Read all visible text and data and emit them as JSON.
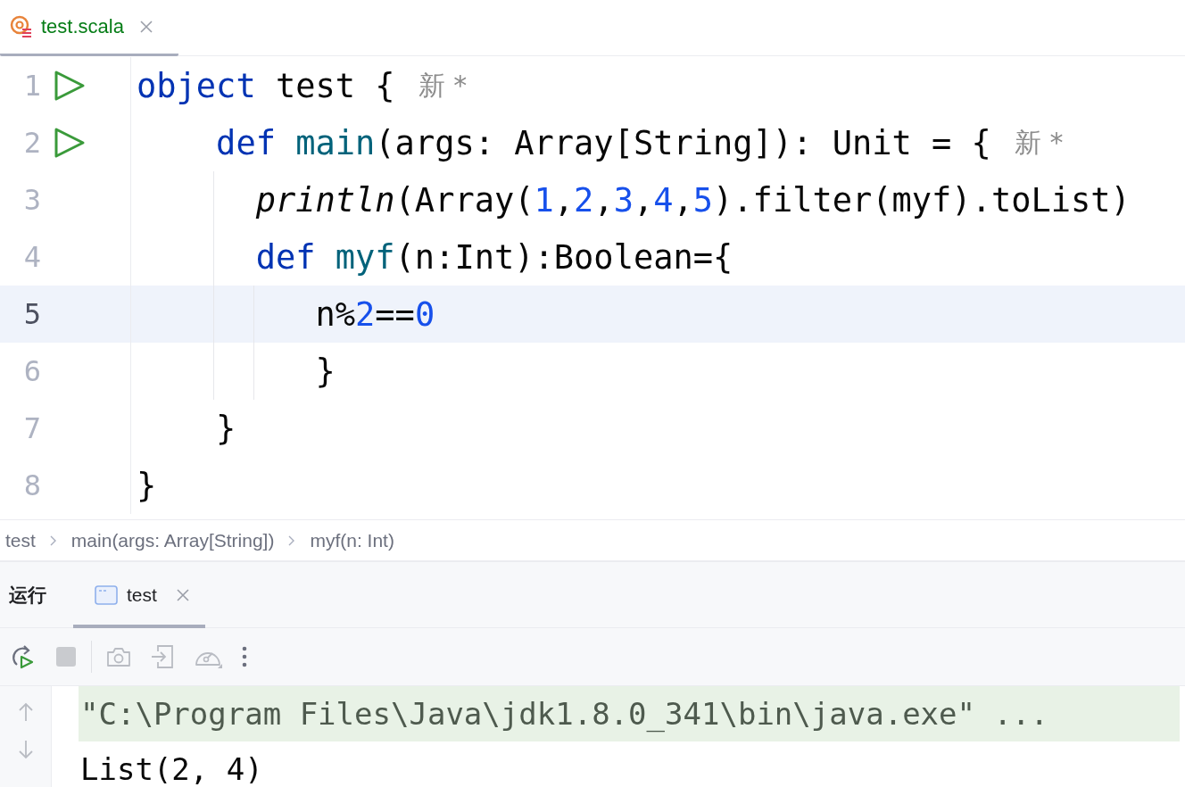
{
  "editor_tab": {
    "file_name": "test.scala",
    "selected": true
  },
  "code_lines": [
    {
      "number": "1",
      "run_button": true,
      "current": false,
      "tokens": [
        {
          "kind": "kw",
          "text": "object"
        },
        {
          "kind": "plain",
          "text": " test {"
        },
        {
          "kind": "hint",
          "text": "新 *"
        }
      ]
    },
    {
      "number": "2",
      "run_button": true,
      "current": false,
      "tokens": [
        {
          "kind": "kw",
          "text": "    def "
        },
        {
          "kind": "fn",
          "text": "main"
        },
        {
          "kind": "plain",
          "text": "(args: Array[String]): Unit = {"
        },
        {
          "kind": "hint",
          "text": "新 *"
        }
      ]
    },
    {
      "number": "3",
      "run_button": false,
      "current": false,
      "tokens": [
        {
          "kind": "call",
          "text": "      println"
        },
        {
          "kind": "plain",
          "text": "(Array("
        },
        {
          "kind": "num",
          "text": "1"
        },
        {
          "kind": "plain",
          "text": ","
        },
        {
          "kind": "num",
          "text": "2"
        },
        {
          "kind": "plain",
          "text": ","
        },
        {
          "kind": "num",
          "text": "3"
        },
        {
          "kind": "plain",
          "text": ","
        },
        {
          "kind": "num",
          "text": "4"
        },
        {
          "kind": "plain",
          "text": ","
        },
        {
          "kind": "num",
          "text": "5"
        },
        {
          "kind": "plain",
          "text": ").filter(myf).toList)"
        }
      ]
    },
    {
      "number": "4",
      "run_button": false,
      "current": false,
      "tokens": [
        {
          "kind": "kw",
          "text": "      def "
        },
        {
          "kind": "fn",
          "text": "myf"
        },
        {
          "kind": "plain",
          "text": "(n:Int):Boolean={"
        }
      ]
    },
    {
      "number": "5",
      "run_button": false,
      "current": true,
      "tokens": [
        {
          "kind": "plain",
          "text": "         n%"
        },
        {
          "kind": "num",
          "text": "2"
        },
        {
          "kind": "plain",
          "text": "=="
        },
        {
          "kind": "num",
          "text": "0"
        }
      ]
    },
    {
      "number": "6",
      "run_button": false,
      "current": false,
      "tokens": [
        {
          "kind": "plain",
          "text": "         }"
        }
      ]
    },
    {
      "number": "7",
      "run_button": false,
      "current": false,
      "tokens": [
        {
          "kind": "plain",
          "text": "    }"
        }
      ]
    },
    {
      "number": "8",
      "run_button": false,
      "current": false,
      "tokens": [
        {
          "kind": "plain",
          "text": "}"
        }
      ]
    }
  ],
  "breadcrumbs": [
    "test",
    "main(args: Array[String])",
    "myf(n: Int)"
  ],
  "run_panel": {
    "title": "运行",
    "tabs": [
      {
        "label": "test",
        "selected": true
      }
    ],
    "console": [
      {
        "kind": "command",
        "text": "\"C:\\Program Files\\Java\\jdk1.8.0_341\\bin\\java.exe\" ..."
      },
      {
        "kind": "output",
        "text": "List(2, 4)"
      }
    ]
  }
}
